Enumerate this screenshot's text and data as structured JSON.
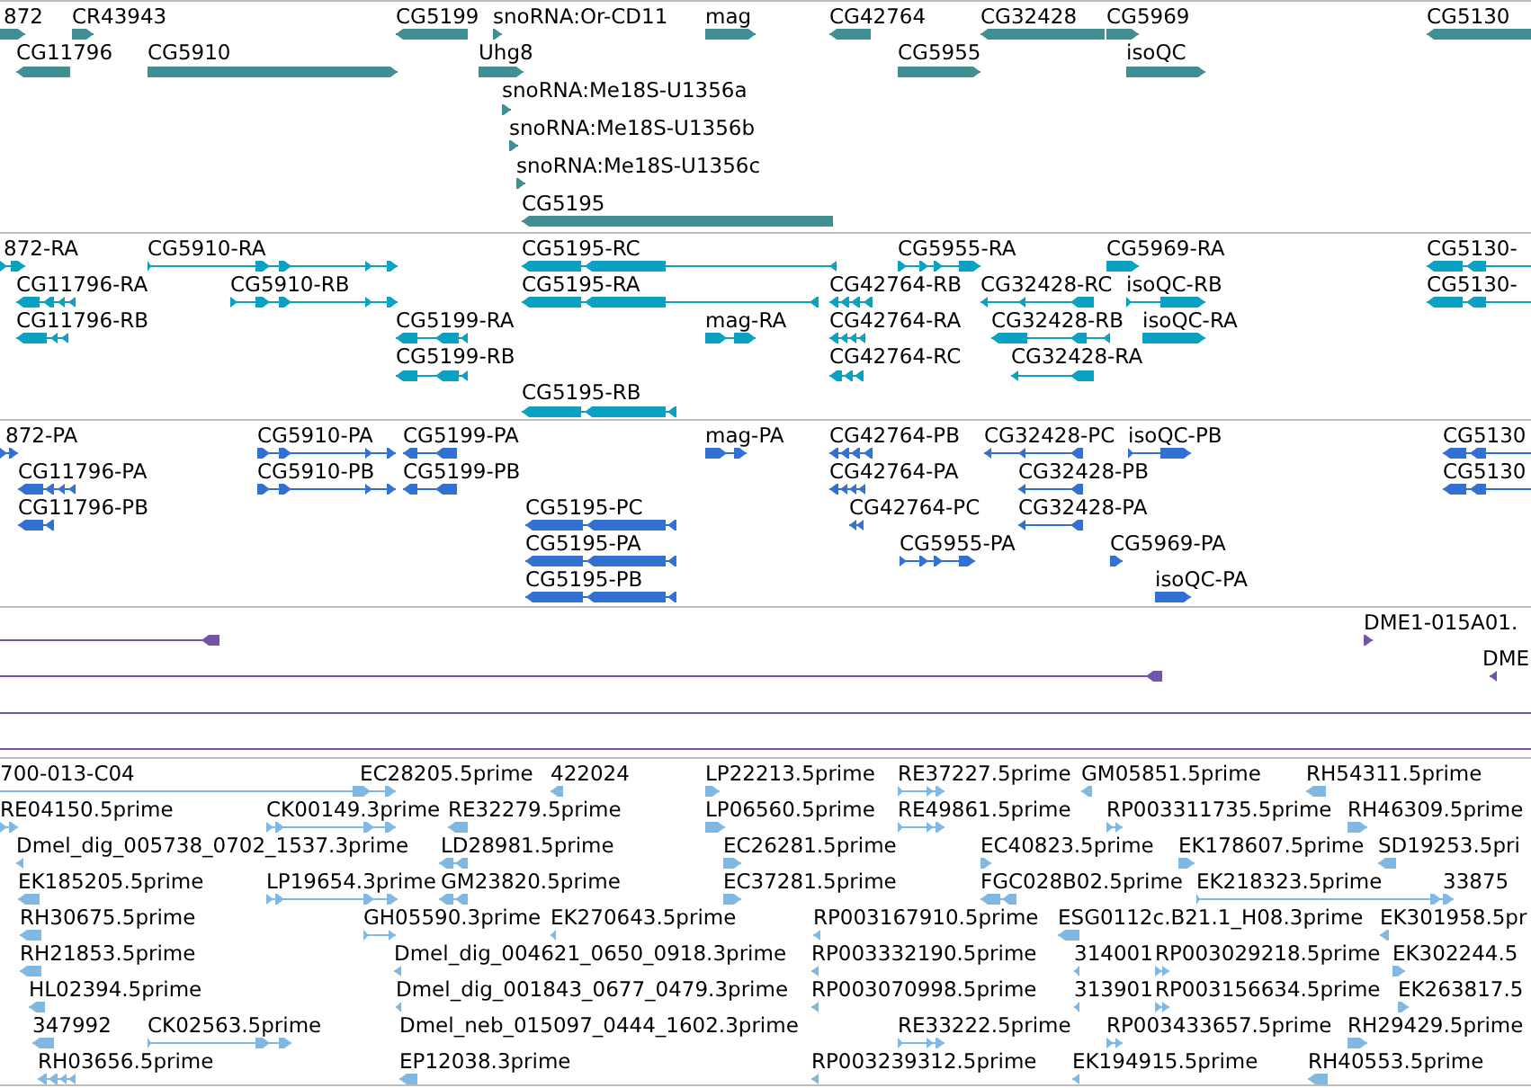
{
  "tracks": [
    {
      "color": "#418e93",
      "rows": [
        {
          "features": [
            {
              "label": "872",
              "reverse": false
            },
            {
              "label": "CR43943",
              "reverse": false
            },
            {
              "label": "CG5199",
              "reverse": true
            },
            {
              "label": "snoRNA:Or-CD11",
              "reverse": false
            },
            {
              "label": "mag",
              "reverse": false
            },
            {
              "label": "CG42764",
              "reverse": true
            },
            {
              "label": "CG32428",
              "reverse": true
            },
            {
              "label": "CG5969",
              "reverse": false
            },
            {
              "label": "CG5130",
              "reverse": true
            }
          ]
        },
        {
          "features": [
            {
              "label": "CG11796",
              "reverse": true
            },
            {
              "label": "CG5910",
              "reverse": false
            },
            {
              "label": "Uhg8",
              "reverse": false
            },
            {
              "label": "CG5955",
              "reverse": false
            },
            {
              "label": "isoQC",
              "reverse": false
            }
          ]
        },
        {
          "features": [
            {
              "label": "snoRNA:Me18S-U1356a",
              "reverse": false
            }
          ]
        },
        {
          "features": [
            {
              "label": "snoRNA:Me18S-U1356b",
              "reverse": false
            }
          ]
        },
        {
          "features": [
            {
              "label": "snoRNA:Me18S-U1356c",
              "reverse": false
            }
          ]
        },
        {
          "features": [
            {
              "label": "CG5195",
              "reverse": true
            }
          ]
        }
      ]
    },
    {
      "color": "#0ba1c2",
      "rows": [
        {
          "features": [
            {
              "label": "872-RA",
              "reverse": false
            },
            {
              "label": "CG5910-RA",
              "reverse": false
            },
            {
              "label": "CG5195-RC",
              "reverse": true
            },
            {
              "label": "CG5955-RA",
              "reverse": false
            },
            {
              "label": "CG5969-RA",
              "reverse": false
            },
            {
              "label": "CG5130-",
              "reverse": true
            }
          ]
        },
        {
          "features": [
            {
              "label": "CG11796-RA",
              "reverse": true
            },
            {
              "label": "CG5910-RB",
              "reverse": false
            },
            {
              "label": "CG5195-RA",
              "reverse": true
            },
            {
              "label": "CG42764-RB",
              "reverse": true
            },
            {
              "label": "CG32428-RC",
              "reverse": true
            },
            {
              "label": "isoQC-RB",
              "reverse": false
            },
            {
              "label": "CG5130-",
              "reverse": true
            }
          ]
        },
        {
          "features": [
            {
              "label": "CG11796-RB",
              "reverse": true
            },
            {
              "label": "CG5199-RA",
              "reverse": true
            },
            {
              "label": "mag-RA",
              "reverse": false
            },
            {
              "label": "CG42764-RA",
              "reverse": true
            },
            {
              "label": "CG32428-RB",
              "reverse": true
            },
            {
              "label": "isoQC-RA",
              "reverse": false
            }
          ]
        },
        {
          "features": [
            {
              "label": "CG5199-RB",
              "reverse": true
            },
            {
              "label": "CG42764-RC",
              "reverse": true
            },
            {
              "label": "CG32428-RA",
              "reverse": true
            }
          ]
        },
        {
          "features": [
            {
              "label": "CG5195-RB",
              "reverse": true
            }
          ]
        }
      ]
    },
    {
      "color": "#3270d2",
      "rows": [
        {
          "features": [
            {
              "label": "872-PA",
              "reverse": false
            },
            {
              "label": "CG5910-PA",
              "reverse": false
            },
            {
              "label": "CG5199-PA",
              "reverse": true
            },
            {
              "label": "mag-PA",
              "reverse": false
            },
            {
              "label": "CG42764-PB",
              "reverse": true
            },
            {
              "label": "CG32428-PC",
              "reverse": true
            },
            {
              "label": "isoQC-PB",
              "reverse": false
            },
            {
              "label": "CG5130",
              "reverse": true
            }
          ]
        },
        {
          "features": [
            {
              "label": "CG11796-PA",
              "reverse": true
            },
            {
              "label": "CG5910-PB",
              "reverse": false
            },
            {
              "label": "CG5199-PB",
              "reverse": true
            },
            {
              "label": "CG42764-PA",
              "reverse": true
            },
            {
              "label": "CG32428-PB",
              "reverse": true
            },
            {
              "label": "CG5130",
              "reverse": true
            }
          ]
        },
        {
          "features": [
            {
              "label": "CG11796-PB",
              "reverse": true
            },
            {
              "label": "CG5195-PC",
              "reverse": true
            },
            {
              "label": "CG42764-PC",
              "reverse": true
            },
            {
              "label": "CG32428-PA",
              "reverse": true
            }
          ]
        },
        {
          "features": [
            {
              "label": "CG5195-PA",
              "reverse": true
            },
            {
              "label": "CG5955-PA",
              "reverse": false
            },
            {
              "label": "CG5969-PA",
              "reverse": false
            }
          ]
        },
        {
          "features": [
            {
              "label": "CG5195-PB",
              "reverse": true
            },
            {
              "label": "isoQC-PA",
              "reverse": false
            }
          ]
        }
      ]
    },
    {
      "color": "#7354a8",
      "rows": [
        {
          "features": [
            {
              "kind": "arrow",
              "reverse": true
            },
            {
              "kind": "arrow",
              "label": "DME1-015A01.",
              "reverse": false
            }
          ]
        },
        {
          "features": [
            {
              "kind": "arrow",
              "reverse": true
            },
            {
              "kind": "arrow",
              "label": "DME",
              "reverse": true
            }
          ]
        },
        {
          "features": [
            {
              "kind": "line"
            }
          ]
        },
        {
          "features": [
            {
              "kind": "line"
            }
          ]
        }
      ]
    },
    {
      "color": "#80b8e2",
      "rows": [
        {
          "features": [
            {
              "label": "700-013-C04",
              "reverse": false
            },
            {
              "label": "EC28205.5prime"
            },
            {
              "label": "422024",
              "reverse": true
            },
            {
              "label": "LP22213.5prime",
              "reverse": false
            },
            {
              "label": "RE37227.5prime",
              "reverse": false
            },
            {
              "label": "GM05851.5prime",
              "reverse": true
            },
            {
              "label": "RH54311.5prime",
              "reverse": true
            }
          ]
        },
        {
          "features": [
            {
              "label": "RE04150.5prime",
              "reverse": false
            },
            {
              "label": "CK00149.3prime",
              "reverse": false
            },
            {
              "label": "RE32279.5prime",
              "reverse": true
            },
            {
              "label": "LP06560.5prime",
              "reverse": false
            },
            {
              "label": "RE49861.5prime",
              "reverse": false
            },
            {
              "label": "RP003311735.5prime",
              "reverse": false
            },
            {
              "label": "RH46309.5prime",
              "reverse": false
            }
          ]
        },
        {
          "features": [
            {
              "label": "Dmel_dig_005738_0702_1537.3prime",
              "reverse": true
            },
            {
              "label": "LD28981.5prime",
              "reverse": true
            },
            {
              "label": "EC26281.5prime",
              "reverse": false
            },
            {
              "label": "EC40823.5prime",
              "reverse": false
            },
            {
              "label": "EK178607.5prime",
              "reverse": false
            },
            {
              "label": "SD19253.5pri",
              "reverse": true
            }
          ]
        },
        {
          "features": [
            {
              "label": "EK185205.5prime",
              "reverse": true
            },
            {
              "label": "LP19654.3prime",
              "reverse": false
            },
            {
              "label": "GM23820.5prime",
              "reverse": true
            },
            {
              "label": "EC37281.5prime",
              "reverse": false
            },
            {
              "label": "FGC028B02.5prime",
              "reverse": true
            },
            {
              "label": "EK218323.5prime",
              "reverse": false
            },
            {
              "label": "33875"
            }
          ]
        },
        {
          "features": [
            {
              "label": "RH30675.5prime",
              "reverse": true
            },
            {
              "label": "GH05590.3prime",
              "reverse": false
            },
            {
              "label": "EK270643.5prime",
              "reverse": true
            },
            {
              "label": "RP003167910.5prime",
              "reverse": true
            },
            {
              "label": "ESG0112c.B21.1_H08.3prime",
              "reverse": true
            },
            {
              "label": "EK301958.5pr",
              "reverse": true
            }
          ]
        },
        {
          "features": [
            {
              "label": "RH21853.5prime",
              "reverse": true
            },
            {
              "label": "Dmel_dig_004621_0650_0918.3prime",
              "reverse": true
            },
            {
              "label": "RP003332190.5prime",
              "reverse": true
            },
            {
              "label": "314001",
              "reverse": true
            },
            {
              "label": "RP003029218.5prime",
              "reverse": false
            },
            {
              "label": "EK302244.5",
              "reverse": false
            }
          ]
        },
        {
          "features": [
            {
              "label": "HL02394.5prime",
              "reverse": true
            },
            {
              "label": "Dmel_dig_001843_0677_0479.3prime",
              "reverse": true
            },
            {
              "label": "RP003070998.5prime",
              "reverse": true
            },
            {
              "label": "313901",
              "reverse": true
            },
            {
              "label": "RP003156634.5prime",
              "reverse": false
            },
            {
              "label": "EK263817.5",
              "reverse": false
            }
          ]
        },
        {
          "features": [
            {
              "label": "347992",
              "reverse": true
            },
            {
              "label": "CK02563.5prime",
              "reverse": false
            },
            {
              "label": "Dmel_neb_015097_0444_1602.3prime"
            },
            {
              "label": "RE33222.5prime",
              "reverse": false
            },
            {
              "label": "RP003433657.5prime",
              "reverse": false
            },
            {
              "label": "RH29429.5prime",
              "reverse": false
            }
          ]
        },
        {
          "features": [
            {
              "label": "RH03656.5prime",
              "reverse": true
            },
            {
              "label": "EP12038.3prime",
              "reverse": true
            },
            {
              "label": "RP003239312.5prime",
              "reverse": true
            },
            {
              "label": "EK194915.5prime",
              "reverse": true
            },
            {
              "label": "RH40553.5prime",
              "reverse": true
            }
          ]
        }
      ]
    }
  ]
}
